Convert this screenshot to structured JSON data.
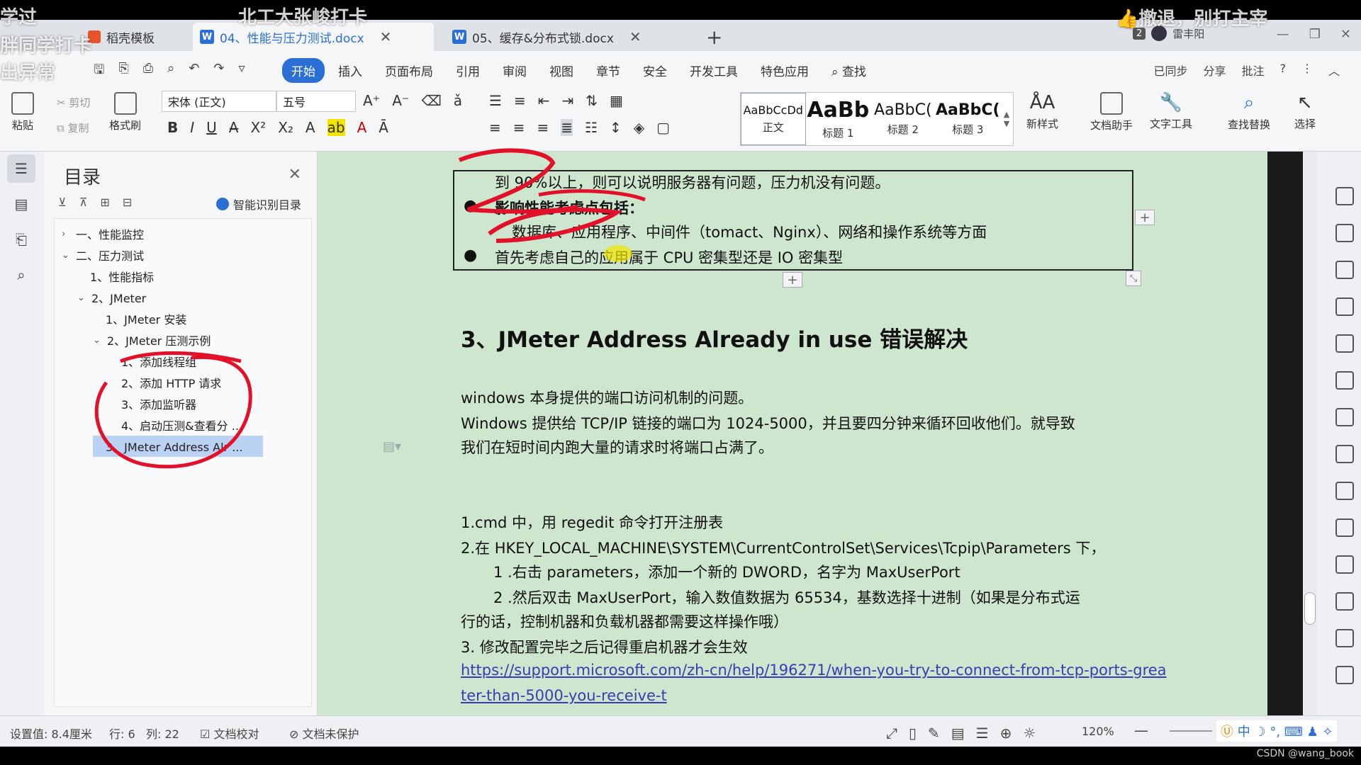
{
  "overlays": {
    "top_left_1": "学过",
    "top_left_2": "胖同学打卡",
    "top_left_3": "出异常",
    "top_center": "北工大张峻打卡",
    "top_right": "撤退，别打主宰"
  },
  "tabs": [
    {
      "label": "稻壳模板"
    },
    {
      "label": "04、性能与压力测试.docx",
      "icon": "W"
    },
    {
      "label": "05、缓存&分布式锁.docx",
      "icon": "W"
    }
  ],
  "user": {
    "badge": "2",
    "name": "雷丰阳"
  },
  "menu": [
    "开始",
    "插入",
    "页面布局",
    "引用",
    "审阅",
    "视图",
    "章节",
    "安全",
    "开发工具",
    "特色应用",
    "查找"
  ],
  "menu_right": [
    "已同步",
    "分享",
    "批注",
    "?"
  ],
  "ribbon": {
    "paste": "粘贴",
    "cut": "剪切",
    "copy": "复制",
    "format_painter": "格式刷",
    "font_name": "宋体 (正文)",
    "font_size": "五号",
    "styles": [
      {
        "sample": "AaBbCcDd",
        "name": "正文"
      },
      {
        "sample": "AaBb",
        "name": "标题 1"
      },
      {
        "sample": "AaBbC(",
        "name": "标题 2"
      },
      {
        "sample": "AaBbC(",
        "name": "标题 3"
      }
    ],
    "new_style": "新样式",
    "doc_helper": "文档助手",
    "text_tools": "文字工具",
    "find_replace": "查找替换",
    "select": "选择"
  },
  "toc": {
    "title": "目录",
    "smart": "智能识别目录",
    "items": [
      {
        "label": "一、性能监控"
      },
      {
        "label": "二、压力测试"
      },
      {
        "label": "1、性能指标"
      },
      {
        "label": "2、JMeter"
      },
      {
        "label": "1、JMeter 安装"
      },
      {
        "label": "2、JMeter 压测示例"
      },
      {
        "label": "1、添加线程组"
      },
      {
        "label": "2、添加 HTTP 请求"
      },
      {
        "label": "3、添加监听器"
      },
      {
        "label": "4、启动压测&查看分 ..."
      },
      {
        "label": "3、JMeter Address Alr ..."
      }
    ]
  },
  "doc": {
    "line1": "到 90%以上，则可以说明服务器有问题，压力机没有问题。",
    "line2": "影响性能考虑点包括：",
    "line3": "数据库、应用程序、中间件（tomact、Nginx）、网络和操作系统等方面",
    "line4": "首先考虑自己的应用属于 CPU 密集型还是 IO 密集型",
    "heading": "3、JMeter Address Already in use 错误解决",
    "p1": "windows 本身提供的端口访问机制的问题。",
    "p2": "Windows 提供给  TCP/IP 链接的端口为  1024-5000，并且要四分钟来循环回收他们。就导致",
    "p3": "我们在短时间内跑大量的请求时将端口占满了。",
    "p4": "1.cmd 中，用 regedit 命令打开注册表",
    "p5": "2.在  HKEY_LOCAL_MACHINE\\SYSTEM\\CurrentControlSet\\Services\\Tcpip\\Parameters 下，",
    "p6": "1 .右击 parameters，添加一个新的 DWORD，名字为 MaxUserPort",
    "p7": "2 .然后双击 MaxUserPort，输入数值数据为 65534，基数选择十进制（如果是分布式运",
    "p8": "行的话，控制机器和负载机器都需要这样操作哦）",
    "p9": "3.  修改配置完毕之后记得重启机器才会生效",
    "link1": "https://support.microsoft.com/zh-cn/help/196271/when-you-try-to-connect-from-tcp-ports-grea",
    "link2": "ter-than-5000-you-receive-t"
  },
  "status": {
    "setting": "设置值: 8.4厘米",
    "row": "行: 6",
    "col": "列: 22",
    "proof": "文档校对",
    "protect": "文档未保护",
    "zoom": "120%",
    "ime": "中"
  },
  "watermark": "CSDN @wang_book",
  "colors": {
    "accent": "#2b6fd6",
    "page_bg": "#cde6cd",
    "annotation": "#e3102a"
  }
}
